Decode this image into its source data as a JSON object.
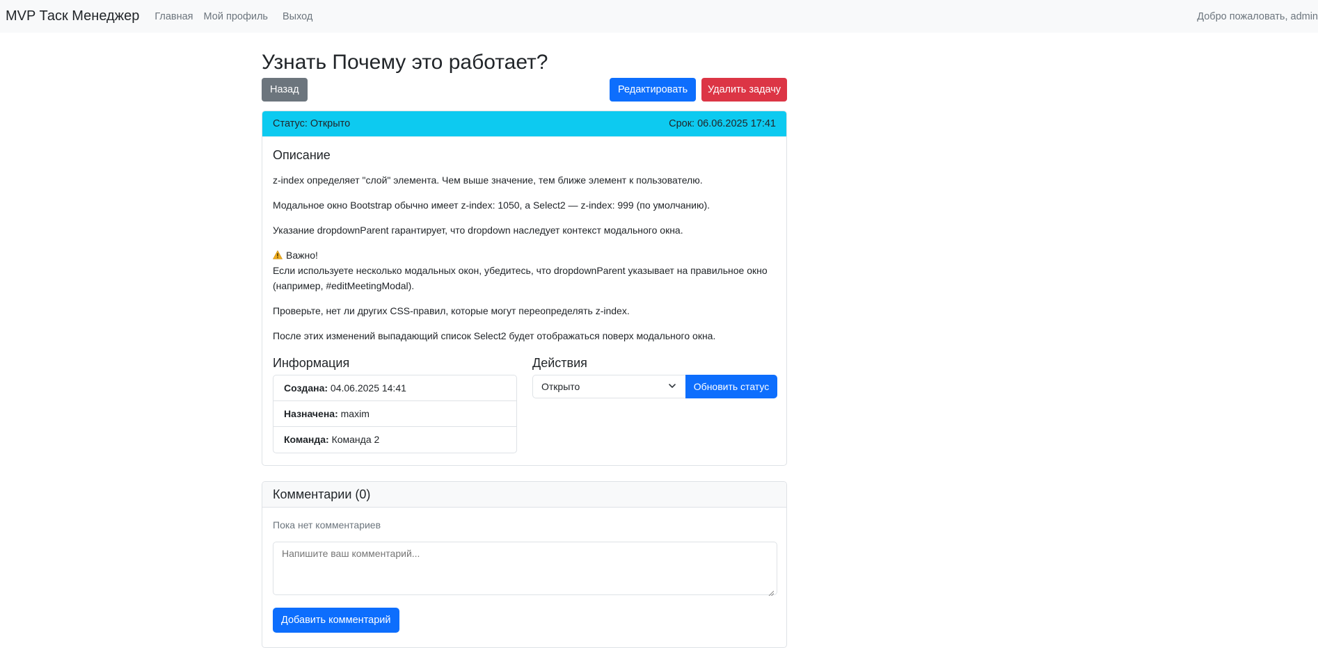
{
  "navbar": {
    "brand": "MVP Таск Менеджер",
    "links": [
      "Главная",
      "Мой профиль",
      "Выход"
    ],
    "welcome": "Добро пожаловать, admin"
  },
  "task": {
    "title": "Узнать Почему это работает?",
    "back_label": "Назад",
    "edit_label": "Редактировать",
    "delete_label": "Удалить задачу",
    "status_text": "Статус: Открыто",
    "due_text": "Срок: 06.06.2025 17:41",
    "description_title": "Описание",
    "description": {
      "p1": "z-index определяет \"слой\" элемента. Чем выше значение, тем ближе элемент к пользователю.",
      "p2": "Модальное окно Bootstrap обычно имеет z-index: 1050, а Select2 — z-index: 999 (по умолчанию).",
      "p3": "Указание dropdownParent гарантирует, что dropdown наследует контекст модального окна.",
      "warn_label": "Важно!",
      "warn_text": "Если используете несколько модальных окон, убедитесь, что dropdownParent указывает на правильное окно (например, #editMeetingModal).",
      "p5": "Проверьте, нет ли других CSS-правил, которые могут переопределять z-index.",
      "p6": "После этих изменений выпадающий список Select2 будет отображаться поверх модального окна."
    },
    "info": {
      "title": "Информация",
      "created_label": "Создана:",
      "created_value": "04.06.2025 14:41",
      "assigned_label": "Назначена:",
      "assigned_value": "maxim",
      "team_label": "Команда:",
      "team_value": "Команда 2"
    },
    "actions": {
      "title": "Действия",
      "status_selected": "Открыто",
      "update_label": "Обновить статус"
    }
  },
  "comments": {
    "title": "Комментарии (0)",
    "empty_text": "Пока нет комментариев",
    "placeholder": "Напишите ваш комментарий...",
    "add_label": "Добавить комментарий"
  },
  "icons": {
    "warning": "warning-icon",
    "chevron": "chevron-down-icon",
    "grip": "resize-grip-icon"
  },
  "colors": {
    "primary": "#0d6efd",
    "danger": "#dc3545",
    "secondary": "#6c757d",
    "info": "#0dcaf0",
    "warning": "#f0ad1e"
  }
}
